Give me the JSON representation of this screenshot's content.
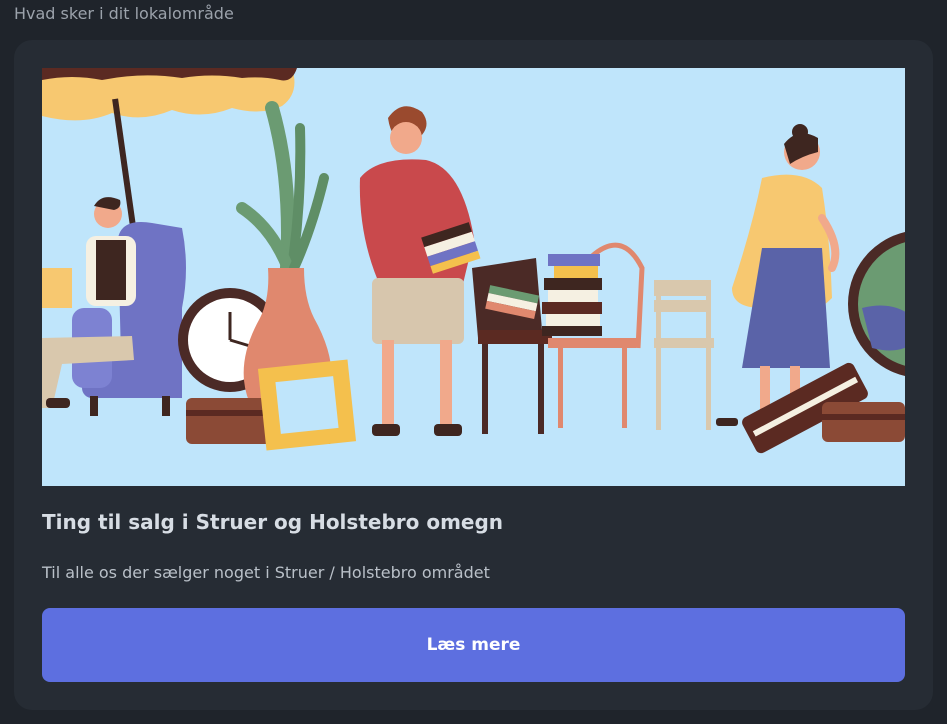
{
  "section": {
    "title": "Hvad sker i dit lokalområde"
  },
  "card": {
    "image_alt": "Illustration af et loppemarked",
    "title": "Ting til salg i Struer og Holstebro omegn",
    "description": "Til alle os der sælger noget i Struer / Holstebro området",
    "button_label": "Læs mere"
  },
  "colors": {
    "background": "#1f242b",
    "card": "#262c34",
    "button": "#5d6fe0",
    "illustration_sky": "#bfe5fb"
  }
}
